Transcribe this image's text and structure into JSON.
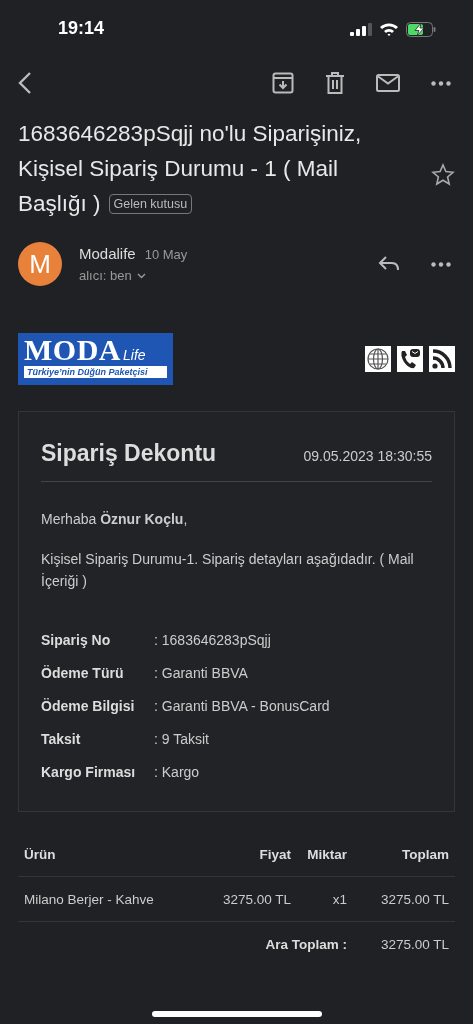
{
  "status_bar": {
    "time": "19:14"
  },
  "subject": {
    "lines": [
      "1683646283pSqjj no'lu Siparişiniz,",
      "Kişisel Sipariş Durumu - 1 ( Mail",
      "Başlığı )"
    ],
    "label": "Gelen kutusu",
    "starred": false
  },
  "sender": {
    "avatar": "M",
    "name": "Modalife",
    "date": "10 May",
    "recipient": "alıcı: ben"
  },
  "logo": {
    "brand": "MODA",
    "brand_suffix": "Life",
    "tagline": "Türkiye’nin Düğün Paketçisi"
  },
  "receipt": {
    "title": "Sipariş Dekontu",
    "datetime": "09.05.2023 18:30:55",
    "greeting": "Merhaba **Öznur Koçlu**,",
    "intro": "Kişisel Sipariş Durumu-1. Sipariş detayları aşağıdadır. ( Mail İçeriği )",
    "details": [
      {
        "label": "Sipariş No",
        "value": ": 1683646283pSqjj"
      },
      {
        "label": "Ödeme Türü",
        "value": ": Garanti BBVA"
      },
      {
        "label": "Ödeme Bilgisi",
        "value": ": Garanti BBVA - BonusCard"
      },
      {
        "label": "Taksit",
        "value": ": 9 Taksit"
      },
      {
        "label": "Kargo Firması",
        "value": ": Kargo"
      }
    ]
  },
  "table": {
    "columns": [
      "Ürün",
      "Fiyat",
      "Miktar",
      "Toplam"
    ],
    "rows": [
      [
        "Milano Berjer - Kahve",
        "3275.00 TL",
        "x1",
        "3275.00 TL"
      ]
    ],
    "subtotal": {
      "label": "Ara Toplam :",
      "value": "3275.00 TL"
    }
  }
}
